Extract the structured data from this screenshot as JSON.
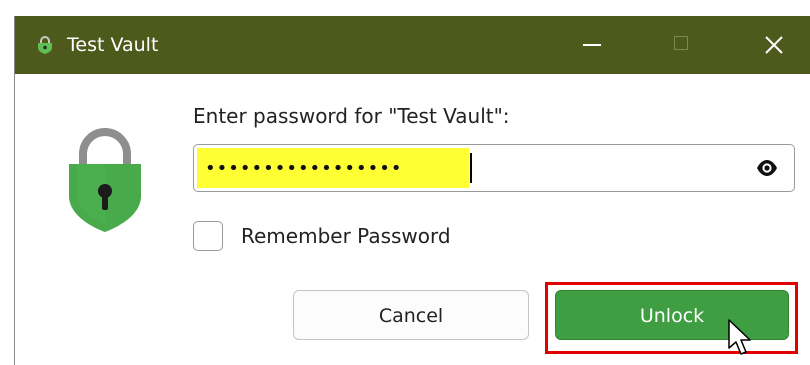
{
  "window": {
    "title": "Test Vault",
    "icon": "padlock-icon"
  },
  "controls": {
    "minimize": "minimize-icon",
    "maximize": "maximize-icon",
    "close": "close-icon"
  },
  "dialog": {
    "prompt": "Enter password for \"Test Vault\":",
    "password": {
      "value": "•••••••••••••••••",
      "toggle_icon": "eye-icon",
      "highlight_color": "#ffff33"
    },
    "remember": {
      "label": "Remember Password",
      "checked": false
    },
    "buttons": {
      "cancel": "Cancel",
      "unlock": "Unlock"
    }
  },
  "colors": {
    "titlebar": "#4d5a1b",
    "lock_green": "#3f9e42",
    "unlock_button": "#3f9e42",
    "highlight_box": "#e00000"
  }
}
